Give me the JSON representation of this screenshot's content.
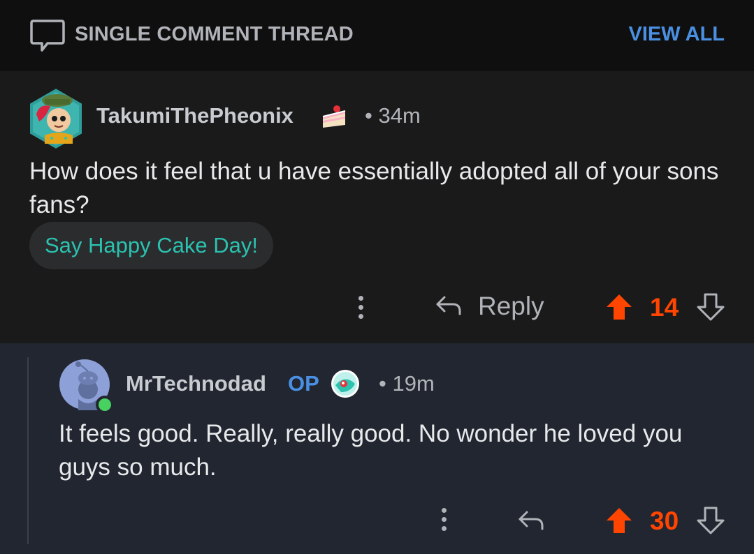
{
  "header": {
    "title": "SINGLE COMMENT THREAD",
    "view_all": "VIEW ALL"
  },
  "comments": [
    {
      "username": "TakumiThePheonix",
      "flair_icon": "cake-slice-icon",
      "time": "• 34m",
      "body": "How does it feel that u have essentially adopted all of your sons fans?",
      "cake_day_button": "Say Happy Cake Day!",
      "reply_label": "Reply",
      "votes": "14"
    },
    {
      "username": "MrTechnodad",
      "op_badge": "OP",
      "flair_icon": "teal-orb-icon",
      "time": "• 19m",
      "body": "It feels good. Really, really good. No wonder he loved you guys so much.",
      "votes": "30",
      "online": true
    }
  ],
  "colors": {
    "accent_blue": "#4a90e2",
    "upvote_orange": "#ff4500",
    "cake_teal": "#2bc2b0"
  }
}
